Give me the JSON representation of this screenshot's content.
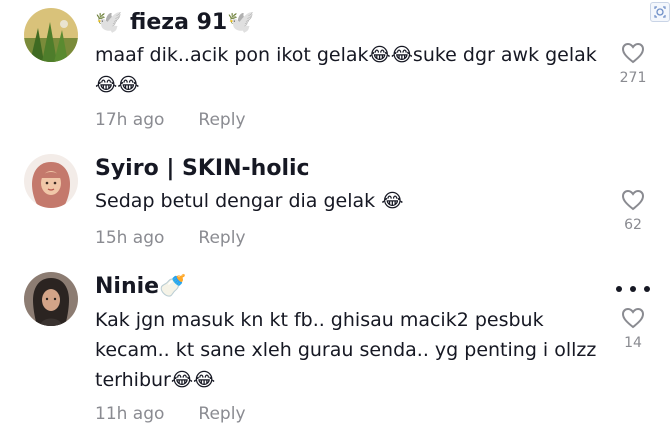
{
  "comments": [
    {
      "username": "🕊️ fieza 91🕊️",
      "text": "maaf dik..acik pon ikot gelak😂😂suke dgr awk gelak 😂😂",
      "time": "17h ago",
      "reply": "Reply",
      "likes": "271",
      "avatar_icon": "plant-avatar"
    },
    {
      "username": "Syiro | SKIN-holic",
      "text": "Sedap betul dengar dia gelak 😂",
      "time": "15h ago",
      "reply": "Reply",
      "likes": "62",
      "avatar_icon": "hijab-avatar"
    },
    {
      "username": "Ninie🍼",
      "text": "Kak jgn masuk kn kt fb.. ghisau macik2 pesbuk kecam.. kt sane xleh gurau senda.. yg penting i ollzz terhibur😂😂",
      "time": "11h ago",
      "reply": "Reply",
      "likes": "14",
      "avatar_icon": "person-avatar"
    }
  ],
  "colors": {
    "text": "#161823",
    "muted": "#8a8b91",
    "background": "#ffffff"
  }
}
